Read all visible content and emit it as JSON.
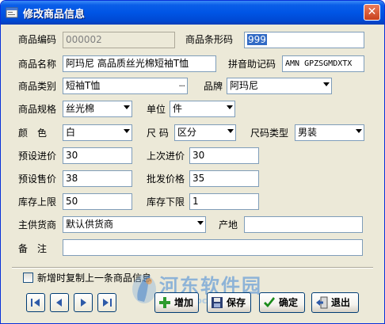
{
  "window": {
    "title": "修改商品信息",
    "close_glyph": "✕"
  },
  "form": {
    "code_label": "商品编码",
    "code_value": "000002",
    "barcode_label": "商品条形码",
    "barcode_value": "999",
    "name_label": "商品名称",
    "name_value": "阿玛尼 高品质丝光棉短袖T恤",
    "pinyin_label": "拼音助记码",
    "pinyin_value": "AMN GPZSGMDXTX",
    "category_label": "商品类别",
    "category_value": "短袖T恤",
    "category_button": "···",
    "brand_label": "品牌",
    "brand_value": "阿玛尼",
    "spec_label": "商品规格",
    "spec_value": "丝光棉",
    "unit_label": "单位",
    "unit_value": "件",
    "color_label": "颜　色",
    "color_value": "白",
    "size_label": "尺 码",
    "size_value": "区分",
    "size_type_label": "尺码类型",
    "size_type_value": "男装",
    "preset_cost_label": "预设进价",
    "preset_cost_value": "30",
    "last_cost_label": "上次进价",
    "last_cost_value": "30",
    "preset_price_label": "预设售价",
    "preset_price_value": "38",
    "wholesale_label": "批发价格",
    "wholesale_value": "35",
    "stock_max_label": "库存上限",
    "stock_max_value": "50",
    "stock_min_label": "库存下限",
    "stock_min_value": "1",
    "supplier_label": "主供货商",
    "supplier_value": "默认供货商",
    "origin_label": "产地",
    "origin_value": "",
    "note_label": "备　注",
    "note_value": ""
  },
  "footer": {
    "copy_checkbox_label": "新增时复制上一条商品信息",
    "copy_checked": false,
    "add_label": "增加",
    "save_label": "保存",
    "ok_label": "确定",
    "exit_label": "退出"
  },
  "watermark": {
    "title": "河东软件园",
    "url": "www.pc0359.cn"
  },
  "colors": {
    "titlebar": "#0055e5",
    "window_bg": "#ece9d8",
    "field_border": "#7f9db9",
    "selection": "#316ac5",
    "add_icon": "#2e9b2e",
    "ok_icon": "#1a8a1a"
  }
}
